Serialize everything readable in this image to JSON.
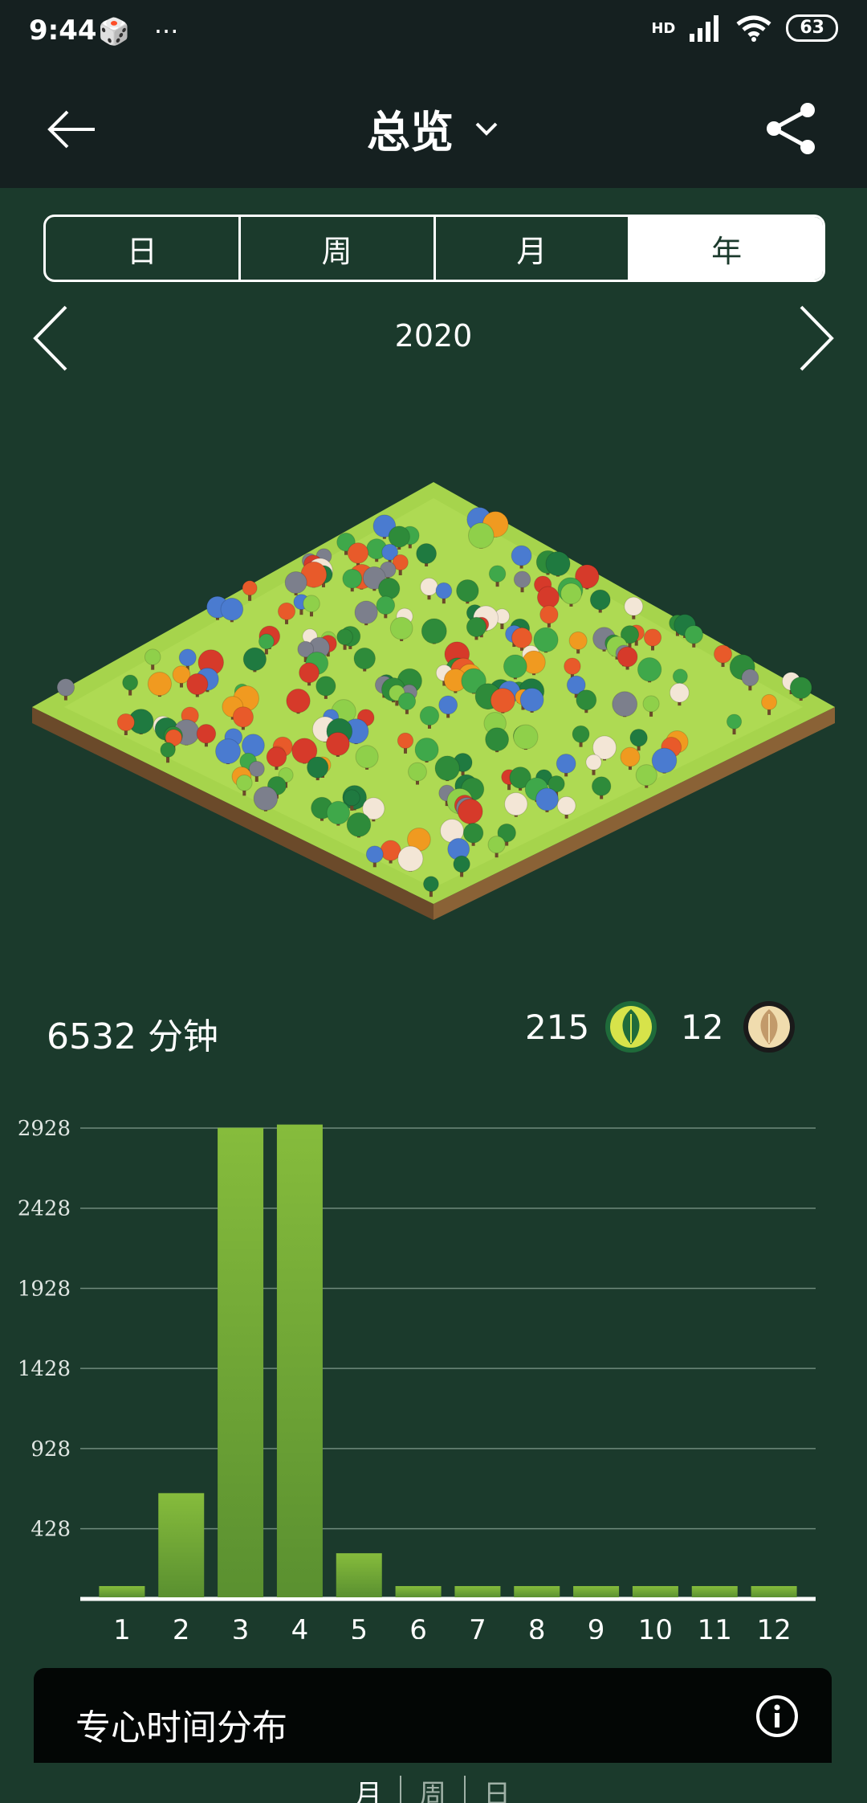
{
  "status_bar": {
    "time": "9:44",
    "more": "···",
    "network": "HD",
    "battery": "63"
  },
  "app_bar": {
    "title": "总览"
  },
  "segments": [
    {
      "label": "日",
      "active": false
    },
    {
      "label": "周",
      "active": false
    },
    {
      "label": "月",
      "active": false
    },
    {
      "label": "年",
      "active": true
    }
  ],
  "period": {
    "label": "2020"
  },
  "stats": {
    "total_minutes": "6532 分钟",
    "live_trees": "215",
    "dead_trees": "12"
  },
  "chart_data": {
    "type": "bar",
    "title": "",
    "xlabel": "",
    "ylabel": "",
    "categories": [
      "1",
      "2",
      "3",
      "4",
      "5",
      "6",
      "7",
      "8",
      "9",
      "10",
      "11",
      "12"
    ],
    "values": [
      70,
      650,
      2930,
      2950,
      275,
      70,
      70,
      70,
      70,
      70,
      70,
      70
    ],
    "y_ticks": [
      428,
      928,
      1428,
      1928,
      2428,
      2928
    ],
    "ylim": [
      0,
      2928
    ],
    "grid": true,
    "colors": {
      "bar_top": "#86bc3c",
      "bar_bottom": "#5a9030",
      "grid": "#6f8a7c"
    }
  },
  "panel": {
    "title": "专心时间分布",
    "tabs": [
      {
        "label": "月",
        "active": true
      },
      {
        "label": "周",
        "active": false
      },
      {
        "label": "日",
        "active": false
      }
    ]
  }
}
